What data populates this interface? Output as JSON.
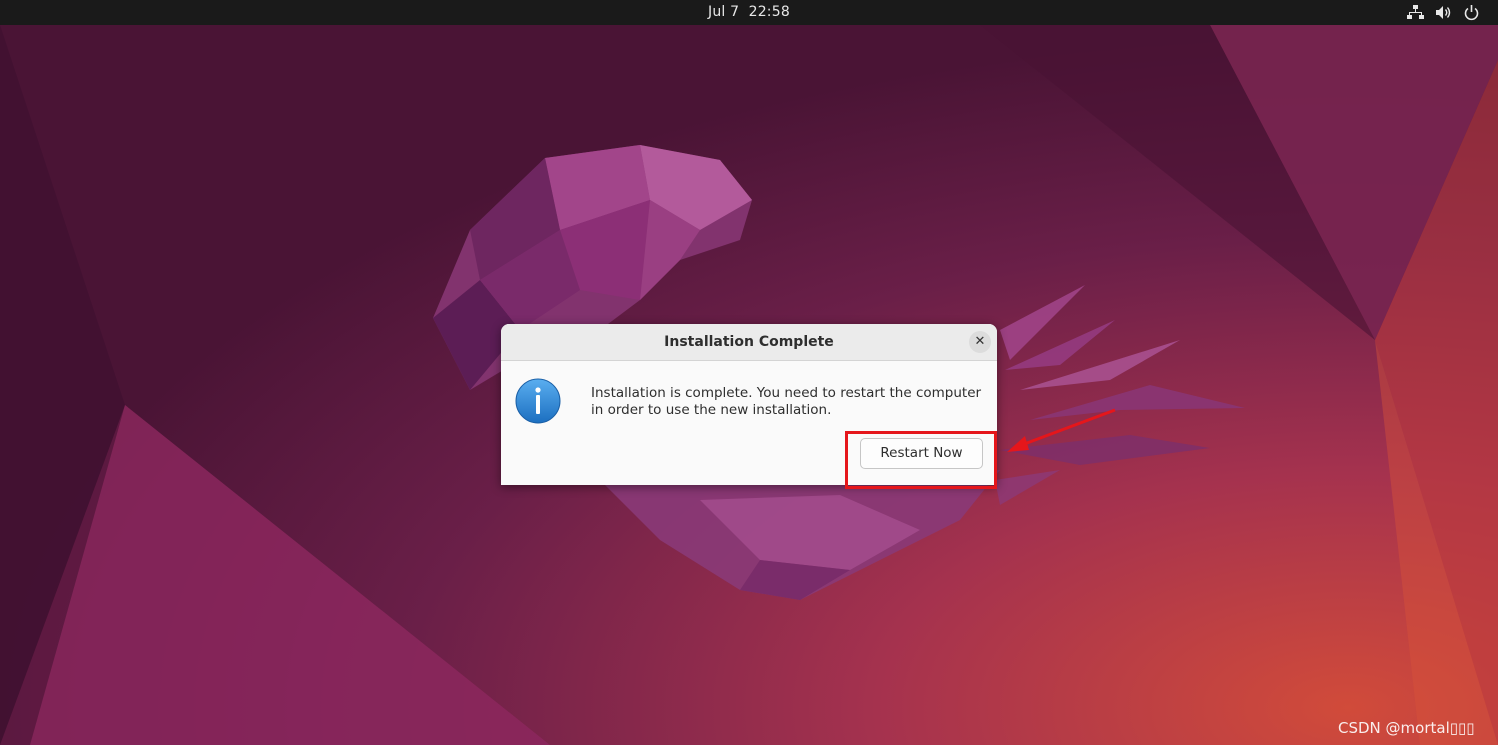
{
  "topbar": {
    "date": "Jul 7",
    "time": "22:58",
    "icons": [
      "network-icon",
      "volume-icon",
      "power-icon"
    ]
  },
  "dialog": {
    "title": "Installation Complete",
    "icon": "info-icon",
    "message_line1": "Installation is complete. You need to restart the computer",
    "message_line2": "in order to use the new installation.",
    "primary_button": "Restart Now",
    "close_glyph": "✕"
  },
  "watermark": "CSDN @mortal▯▯▯",
  "colors": {
    "topbar_bg": "#1a1a1a",
    "dialog_bg": "#fafafa",
    "dialog_header_bg": "#ebebeb",
    "highlight": "#e5161b",
    "info_blue": "#2a84d2",
    "wallpaper_base": "#5e1d44"
  }
}
